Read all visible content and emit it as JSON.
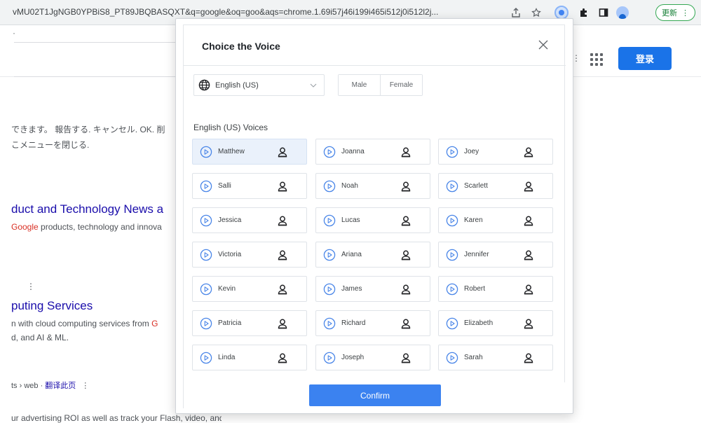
{
  "browser": {
    "url": "vMU02T1JgNGB0YPBiS8_PT89JBQBASQXT&q=google&oq=goo&aqs=chrome.1.69i57j46i199i465i512j0i512l2j...",
    "update_label": "更新",
    "update_menu_glyph": "⋮"
  },
  "google_page": {
    "subbar_glyph": "·",
    "login_label": "登录",
    "kebab_glyph": "⋮",
    "snippet_jp_1": "できます。 報告する. キャンセル. OK. 削",
    "snippet_jp_2": "こメニューを閉じる.",
    "result1_title": "duct and Technology News a",
    "result1_snippet_red": "Google",
    "result1_snippet_rest": " products, technology and innova",
    "result2_kebab": "⋮",
    "result2_title": "puting Services",
    "result2_snippet_1a": "n with cloud computing services from ",
    "result2_snippet_1b": "G",
    "result2_snippet_2": "d, and AI & ML.",
    "result3_breadcrumb": "ts › web · ",
    "result3_translate": "翻译此页",
    "result3_kebab": "⋮",
    "result3_snippet": "ur advertising ROI as well as track your Flash, video, and"
  },
  "modal": {
    "title": "Choice the Voice",
    "language": "English (US)",
    "gender_options": [
      "Male",
      "Female"
    ],
    "section_title": "English (US) Voices",
    "confirm_label": "Confirm",
    "voices": [
      {
        "name": "Matthew",
        "selected": true
      },
      {
        "name": "Joanna"
      },
      {
        "name": "Joey"
      },
      {
        "name": "Salli"
      },
      {
        "name": "Noah"
      },
      {
        "name": "Scarlett"
      },
      {
        "name": "Jessica"
      },
      {
        "name": "Lucas"
      },
      {
        "name": "Karen"
      },
      {
        "name": "Victoria"
      },
      {
        "name": "Ariana"
      },
      {
        "name": "Jennifer"
      },
      {
        "name": "Kevin"
      },
      {
        "name": "James"
      },
      {
        "name": "Robert"
      },
      {
        "name": "Patricia"
      },
      {
        "name": "Richard"
      },
      {
        "name": "Elizabeth"
      },
      {
        "name": "Linda"
      },
      {
        "name": "Joseph"
      },
      {
        "name": "Sarah"
      }
    ]
  },
  "colors": {
    "accent": "#3b82f0",
    "selected_card": "#eaf1fb",
    "google_link": "#1a0dab",
    "google_blue": "#1a73e8"
  }
}
